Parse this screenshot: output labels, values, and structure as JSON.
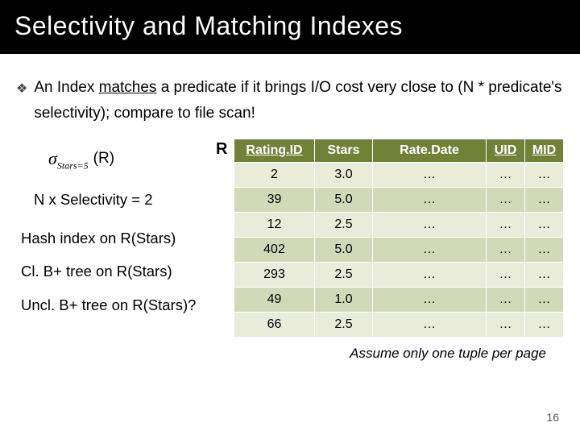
{
  "title": "Selectivity and Matching Indexes",
  "bullet": {
    "icon": "❖",
    "pre": "An Index ",
    "underlined": "matches",
    "post": " a predicate if it brings I/O cost very close to (N * predicate's selectivity); compare to file scan!"
  },
  "formula": {
    "sigma": "σ",
    "sub": "Stars=5",
    "of": "(R)"
  },
  "left": {
    "selectivity": "N x Selectivity = 2",
    "idx1": "Hash index on R(Stars)",
    "idx2": "Cl. B+ tree on R(Stars)",
    "idx3": "Uncl. B+ tree on R(Stars)?"
  },
  "table": {
    "label": "R",
    "headers": {
      "rid": "Rating.ID",
      "stars": "Stars",
      "date": "Rate.Date",
      "uid": "UID",
      "mid": "MID"
    },
    "rows": [
      {
        "rid": "2",
        "stars": "3.0",
        "date": "…",
        "uid": "…",
        "mid": "…"
      },
      {
        "rid": "39",
        "stars": "5.0",
        "date": "…",
        "uid": "…",
        "mid": "…"
      },
      {
        "rid": "12",
        "stars": "2.5",
        "date": "…",
        "uid": "…",
        "mid": "…"
      },
      {
        "rid": "402",
        "stars": "5.0",
        "date": "…",
        "uid": "…",
        "mid": "…"
      },
      {
        "rid": "293",
        "stars": "2.5",
        "date": "…",
        "uid": "…",
        "mid": "…"
      },
      {
        "rid": "49",
        "stars": "1.0",
        "date": "…",
        "uid": "…",
        "mid": "…"
      },
      {
        "rid": "66",
        "stars": "2.5",
        "date": "…",
        "uid": "…",
        "mid": "…"
      }
    ]
  },
  "footnote": "Assume only one tuple per page",
  "page_number": "16",
  "chart_data": {
    "type": "table",
    "title": "R",
    "columns": [
      "Rating.ID",
      "Stars",
      "Rate.Date",
      "UID",
      "MID"
    ],
    "rows": [
      [
        2,
        3.0,
        null,
        null,
        null
      ],
      [
        39,
        5.0,
        null,
        null,
        null
      ],
      [
        12,
        2.5,
        null,
        null,
        null
      ],
      [
        402,
        5.0,
        null,
        null,
        null
      ],
      [
        293,
        2.5,
        null,
        null,
        null
      ],
      [
        49,
        1.0,
        null,
        null,
        null
      ],
      [
        66,
        2.5,
        null,
        null,
        null
      ]
    ]
  }
}
